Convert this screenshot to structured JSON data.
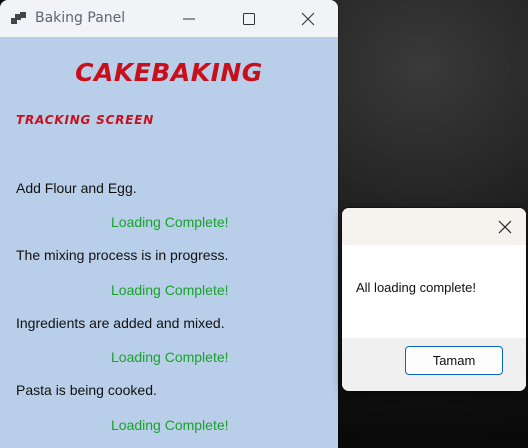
{
  "window": {
    "title": "Baking Panel",
    "brand": "CAKEBAKING",
    "subtitle": "TRACKING SCREEN",
    "steps": [
      {
        "label": "Add Flour and Egg.",
        "status": "Loading Complete!"
      },
      {
        "label": "The mixing process is in progress.",
        "status": "Loading Complete!"
      },
      {
        "label": "Ingredients are added and mixed.",
        "status": "Loading Complete!"
      },
      {
        "label": "Pasta is being cooked.",
        "status": "Loading Complete!"
      }
    ]
  },
  "dialog": {
    "message": "All loading complete!",
    "ok_label": "Tamam"
  },
  "icons": {
    "app": "app-window-icon",
    "minimize": "minimize-icon",
    "maximize": "maximize-icon",
    "close": "close-icon"
  },
  "colors": {
    "window_bg": "#b9cfe9",
    "brand": "#c8101c",
    "status": "#17a32a",
    "accent": "#0a66c8"
  }
}
